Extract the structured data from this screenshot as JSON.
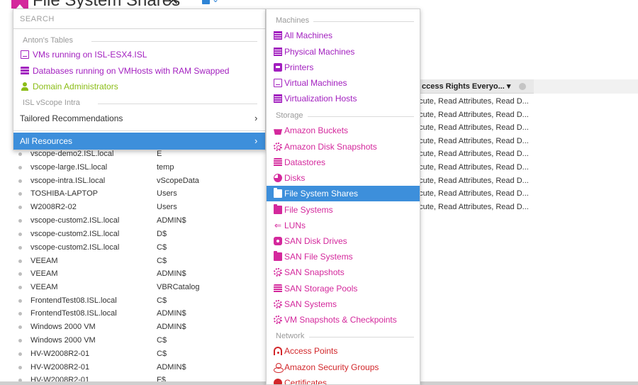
{
  "page": {
    "title": "File System Shares",
    "close_glyph": "✕",
    "save_chevron": "⌄",
    "colors": {
      "accent": "#d4289c",
      "selection": "#3d8fdb",
      "purple": "#a21fbf",
      "green": "#8bbd17",
      "red": "#d2272b"
    }
  },
  "table": {
    "column_header": "ccess Rights Everyo... ▾",
    "rights_cells": [
      "ecute, Read Attributes, Read D...",
      "ecute, Read Attributes, Read D...",
      "ecute, Read Attributes, Read D...",
      "ecute, Read Attributes, Read D...",
      "ecute, Read Attributes, Read D...",
      "ecute, Read Attributes, Read D...",
      "ecute, Read Attributes, Read D...",
      "ecute, Read Attributes, Read D...",
      "ecute, Read Attributes, Read D..."
    ],
    "rows": [
      {
        "host": "vscope-demo2.ISL.local",
        "share": "E"
      },
      {
        "host": "vscope-large.ISL.local",
        "share": "temp"
      },
      {
        "host": "vscope-intra.ISL.local",
        "share": "vScopeData"
      },
      {
        "host": "TOSHIBA-LAPTOP",
        "share": "Users"
      },
      {
        "host": "W2008R2-02",
        "share": "Users"
      },
      {
        "host": "vscope-custom2.ISL.local",
        "share": "ADMIN$"
      },
      {
        "host": "vscope-custom2.ISL.local",
        "share": "D$"
      },
      {
        "host": "vscope-custom2.ISL.local",
        "share": "C$"
      },
      {
        "host": "VEEAM",
        "share": "C$"
      },
      {
        "host": "VEEAM",
        "share": "ADMIN$"
      },
      {
        "host": "VEEAM",
        "share": "VBRCatalog"
      },
      {
        "host": "FrontendTest08.ISL.local",
        "share": "C$"
      },
      {
        "host": "FrontendTest08.ISL.local",
        "share": "ADMIN$"
      },
      {
        "host": "Windows 2000 VM",
        "share": "ADMIN$"
      },
      {
        "host": "Windows 2000 VM",
        "share": "C$"
      },
      {
        "host": "HV-W2008R2-01",
        "share": "C$"
      },
      {
        "host": "HV-W2008R2-01",
        "share": "ADMIN$"
      },
      {
        "host": "HV-W2008R2-01",
        "share": "F$"
      }
    ]
  },
  "left_menu": {
    "search_placeholder": "SEARCH",
    "group1_label": "Anton's Tables",
    "group1_items": [
      {
        "label": "VMs running on ISL-ESX4.ISL",
        "icon": "table-icon"
      },
      {
        "label": "Databases running on VMHosts with RAM Swapped",
        "icon": "database-icon"
      },
      {
        "label": "Domain Administrators",
        "icon": "person-icon"
      }
    ],
    "group2_label": "ISL vScope Intra",
    "tailored": "Tailored Recommendations",
    "all_resources": "All Resources",
    "chevron": "›"
  },
  "sub_menu": {
    "machines_label": "Machines",
    "machines": [
      {
        "label": "All Machines",
        "icon": "server-icon"
      },
      {
        "label": "Physical Machines",
        "icon": "server-icon"
      },
      {
        "label": "Printers",
        "icon": "printer-icon"
      },
      {
        "label": "Virtual Machines",
        "icon": "vm-icon"
      },
      {
        "label": "Virtualization Hosts",
        "icon": "host-icon"
      }
    ],
    "storage_label": "Storage",
    "storage": [
      {
        "label": "Amazon Buckets",
        "icon": "bucket-icon"
      },
      {
        "label": "Amazon Disk Snapshots",
        "icon": "snapshot-icon"
      },
      {
        "label": "Datastores",
        "icon": "datastore-icon"
      },
      {
        "label": "Disks",
        "icon": "disk-icon"
      },
      {
        "label": "File System Shares",
        "icon": "folder-icon"
      },
      {
        "label": "File Systems",
        "icon": "folder-icon"
      },
      {
        "label": "LUNs",
        "icon": "lun-icon"
      },
      {
        "label": "SAN Disk Drives",
        "icon": "drive-icon"
      },
      {
        "label": "SAN File Systems",
        "icon": "folder-icon"
      },
      {
        "label": "SAN Snapshots",
        "icon": "snapshot-icon"
      },
      {
        "label": "SAN Storage Pools",
        "icon": "pool-icon"
      },
      {
        "label": "SAN Systems",
        "icon": "san-system-icon"
      },
      {
        "label": "VM Snapshots & Checkpoints",
        "icon": "snapshot-icon"
      }
    ],
    "network_label": "Network",
    "network": [
      {
        "label": "Access Points",
        "icon": "wifi-icon"
      },
      {
        "label": "Amazon Security Groups",
        "icon": "security-group-icon"
      },
      {
        "label": "Certificates",
        "icon": "certificate-icon"
      }
    ],
    "lun_glyph": "⇐"
  }
}
